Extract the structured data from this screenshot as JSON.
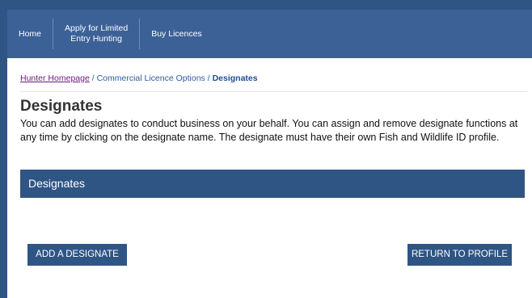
{
  "nav": {
    "items": [
      {
        "label": "Home"
      },
      {
        "label_line1": "Apply for Limited",
        "label_line2": "Entry Hunting"
      },
      {
        "label": "Buy Licences"
      }
    ]
  },
  "breadcrumb": {
    "home": "Hunter Homepage",
    "sep1": " / ",
    "mid": "Commercial Licence Options",
    "sep2": " / ",
    "current": "Designates"
  },
  "page": {
    "title": "Designates",
    "description": "You can add designates to conduct business on your behalf. You can assign and remove designate functions at any time by clicking on the designate name. The designate must have their own Fish and Wildlife ID profile."
  },
  "panel": {
    "header": "Designates"
  },
  "buttons": {
    "add": "ADD A DESIGNATE",
    "return": "RETURN TO PROFILE"
  },
  "colors": {
    "nav_bg": "#3b6197",
    "panel_bg": "#2f5584",
    "link_visited": "#6a1b7a",
    "link": "#2c5c97"
  }
}
